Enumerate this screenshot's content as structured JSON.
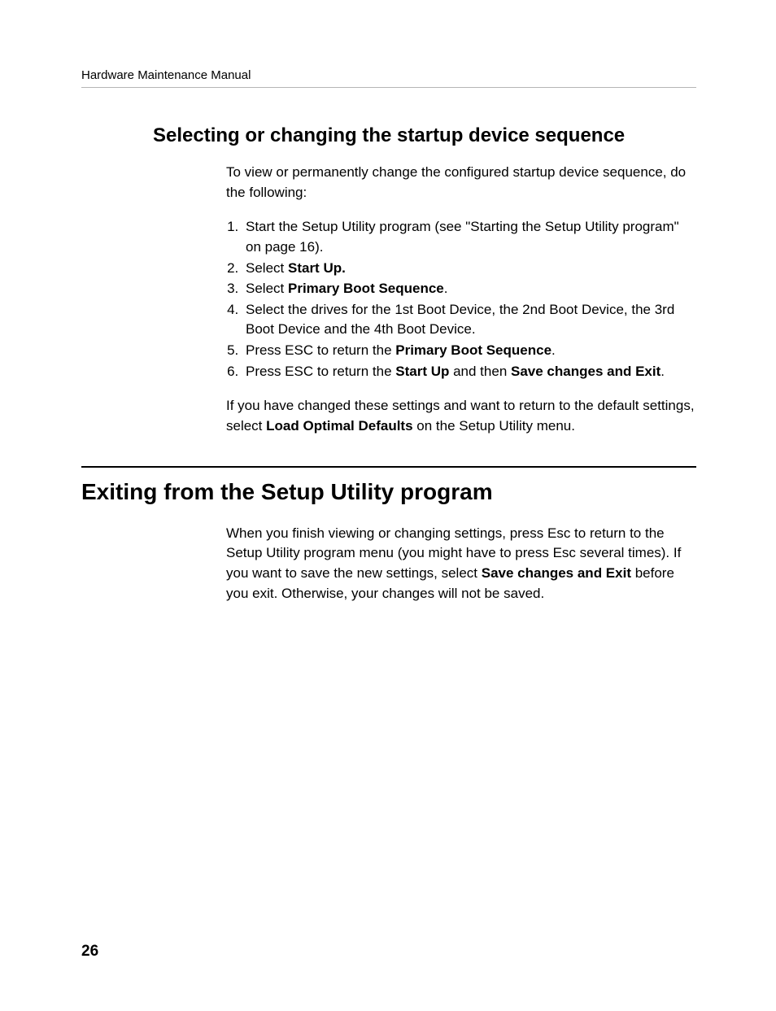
{
  "header": {
    "running_title": "Hardware Maintenance Manual"
  },
  "section1": {
    "heading": "Selecting or changing the startup device sequence",
    "intro": "To view or permanently change the configured startup device sequence, do the following:",
    "steps": {
      "s1a": "Start the Setup Utility program (see \"Starting the Setup Utility program\" on page 16).",
      "s2a": "Select ",
      "s2b": "Start Up.",
      "s3a": "Select ",
      "s3b": "Primary Boot Sequence",
      "s3c": ".",
      "s4a": "Select the drives for the 1st Boot Device, the 2nd Boot Device, the 3rd Boot Device and the 4th Boot Device.",
      "s5a": "Press ESC to return the ",
      "s5b": "Primary Boot Sequence",
      "s5c": ".",
      "s6a": "Press ESC to return the ",
      "s6b": "Start Up",
      "s6c": " and then ",
      "s6d": "Save changes and Exit",
      "s6e": "."
    },
    "outro_a": "If you have changed these settings and want to return to the default settings, select ",
    "outro_b": "Load Optimal Defaults",
    "outro_c": " on the Setup Utility menu."
  },
  "section2": {
    "heading": "Exiting from the Setup Utility program",
    "body_a": "When you finish viewing or changing settings, press Esc to return to the Setup Utility program menu (you might have to press Esc several times). If you want to save the new settings, select ",
    "body_b": "Save changes and Exit",
    "body_c": " before you exit. Otherwise, your changes will not be saved."
  },
  "footer": {
    "page_number": "26"
  }
}
